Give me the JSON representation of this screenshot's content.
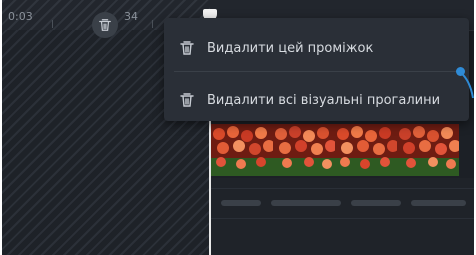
{
  "ruler": {
    "time_left": "0:03",
    "time_gap": "34"
  },
  "context_menu": {
    "items": [
      {
        "label": "Видалити цей проміжок",
        "icon": "trash-icon"
      },
      {
        "label": "Видалити всі візуальні прогалини",
        "icon": "trash-icon"
      }
    ]
  },
  "colors": {
    "accent": "#2f8bd6",
    "menu_bg": "#2a2f37",
    "timeline_bg": "#1c2026"
  }
}
